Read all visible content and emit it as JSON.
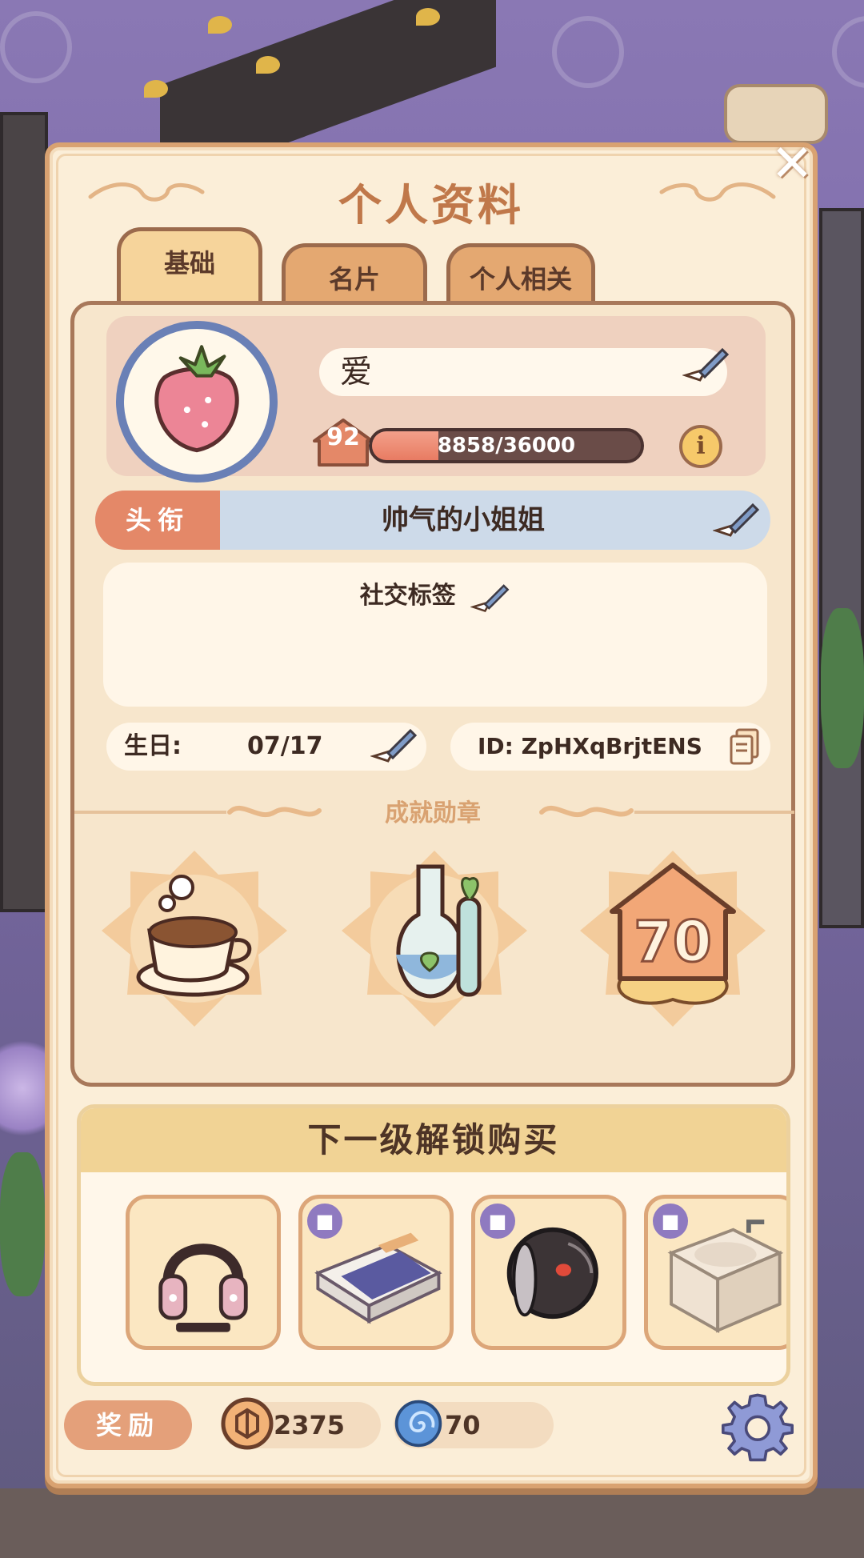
{
  "panel": {
    "title": "个人资料",
    "close_symbol": "✕"
  },
  "tabs": [
    {
      "label": "基础",
      "active": true
    },
    {
      "label": "名片",
      "active": false
    },
    {
      "label": "个人相关",
      "active": false
    }
  ],
  "profile": {
    "avatar_icon": "strawberry-icon",
    "name": "爱",
    "level": "92",
    "exp_text": "8858/36000",
    "exp_fraction": 0.246,
    "info_symbol": "i"
  },
  "title_row": {
    "label": "头衔",
    "value": "帅气的小姐姐"
  },
  "tags": {
    "label": "社交标签"
  },
  "birthday": {
    "label": "生日:",
    "value": "07/17"
  },
  "id": {
    "text": "ID: ZpHXqBrjtENS"
  },
  "achievements": {
    "header": "成就勋章",
    "badges": [
      {
        "icon": "latte-coffee-icon"
      },
      {
        "icon": "flask-plant-icon"
      },
      {
        "icon": "level-70-badge-icon",
        "number": "70"
      }
    ]
  },
  "unlock": {
    "header": "下一级解锁购买",
    "items": [
      {
        "icon": "headphones-icon",
        "locked": false
      },
      {
        "icon": "bed-icon",
        "locked": true
      },
      {
        "icon": "round-lamp-icon",
        "locked": true
      },
      {
        "icon": "sink-cabinet-icon",
        "locked": true
      }
    ]
  },
  "rewards": {
    "label": "奖励",
    "coins": "2375",
    "gems": "70"
  },
  "colors": {
    "panel_bg": "#fbeed8",
    "accent_orange": "#e48868",
    "title_blue": "#cddae9",
    "text_brown": "#3d2a22"
  }
}
